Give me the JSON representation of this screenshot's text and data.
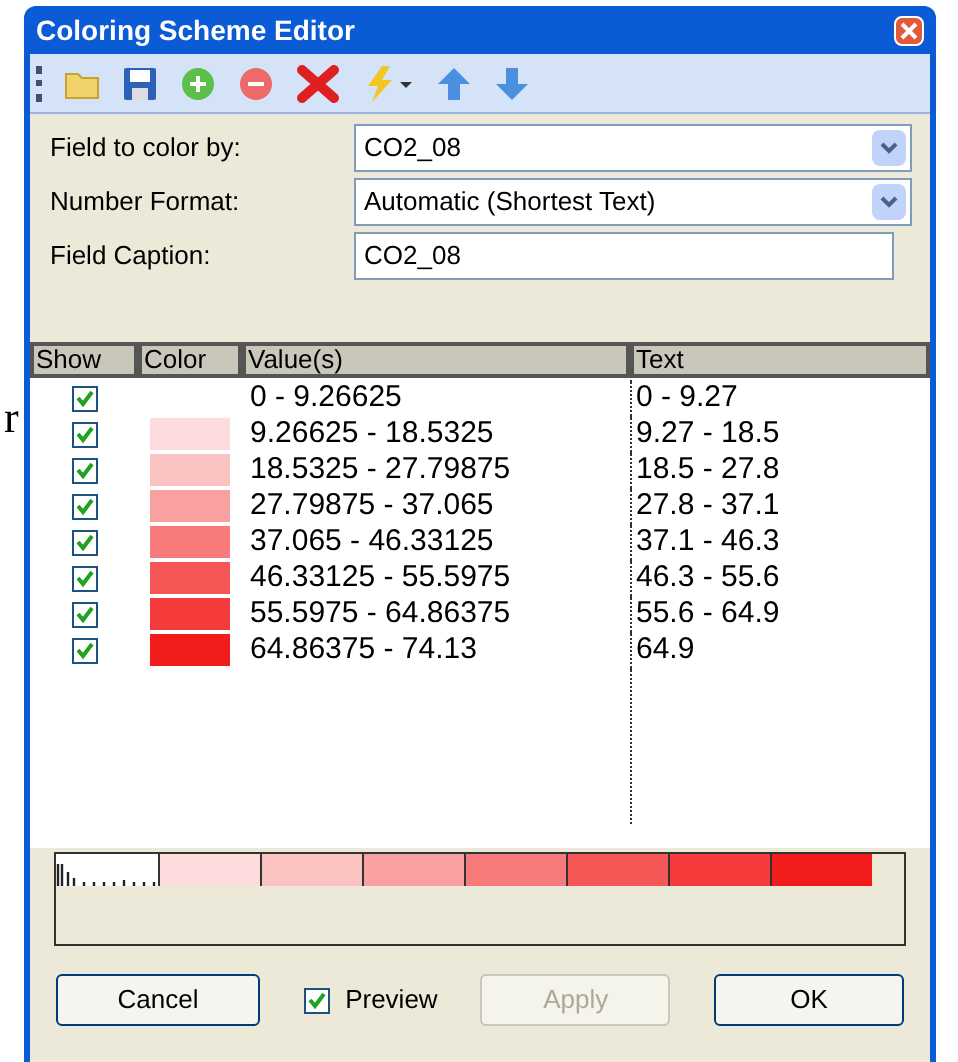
{
  "background_fragment": "r",
  "window": {
    "title": "Coloring Scheme Editor"
  },
  "toolbar": [
    {
      "kind": "open"
    },
    {
      "kind": "save"
    },
    {
      "kind": "add"
    },
    {
      "kind": "remove"
    },
    {
      "kind": "delete"
    },
    {
      "kind": "auto"
    },
    {
      "kind": "up"
    },
    {
      "kind": "down"
    }
  ],
  "fields": [
    {
      "kind": "dropdown",
      "label": "Field to color by:",
      "value": "CO2_08"
    },
    {
      "kind": "dropdown",
      "label": "Number Format:",
      "value": "Automatic (Shortest Text)"
    },
    {
      "kind": "text",
      "label": "Field Caption:",
      "value": "CO2_08"
    }
  ],
  "table": {
    "columns": [
      "Show",
      "Color",
      "Value(s)",
      "Text"
    ],
    "rows": [
      {
        "checked": true,
        "values": "0 - 9.26625",
        "text": "0 - 9.27"
      },
      {
        "checked": true,
        "color": "#fcdcdc",
        "values": "9.26625 - 18.5325",
        "text": "9.27 - 18.5"
      },
      {
        "checked": true,
        "color": "#fbc2c2",
        "values": "18.5325 - 27.79875",
        "text": "18.5 - 27.8"
      },
      {
        "checked": true,
        "color": "#f9a0a0",
        "values": "27.79875 - 37.065",
        "text": "27.8 - 37.1"
      },
      {
        "checked": true,
        "color": "#f77b7b",
        "values": "37.065 - 46.33125",
        "text": "37.1 - 46.3"
      },
      {
        "checked": true,
        "color": "#f55656",
        "values": "46.33125 - 55.5975",
        "text": "46.3 - 55.6"
      },
      {
        "checked": true,
        "color": "#f43a3a",
        "values": "55.5975 - 64.86375",
        "text": "55.6 - 64.9"
      },
      {
        "checked": true,
        "color": "#f21c1c",
        "values": "64.86375 - 74.13",
        "text": "64.9"
      }
    ]
  },
  "footer": {
    "cancel": "Cancel",
    "preview": {
      "label": "Preview",
      "checked": true
    },
    "apply": {
      "label": "Apply",
      "disabled": true
    },
    "ok": "OK"
  }
}
